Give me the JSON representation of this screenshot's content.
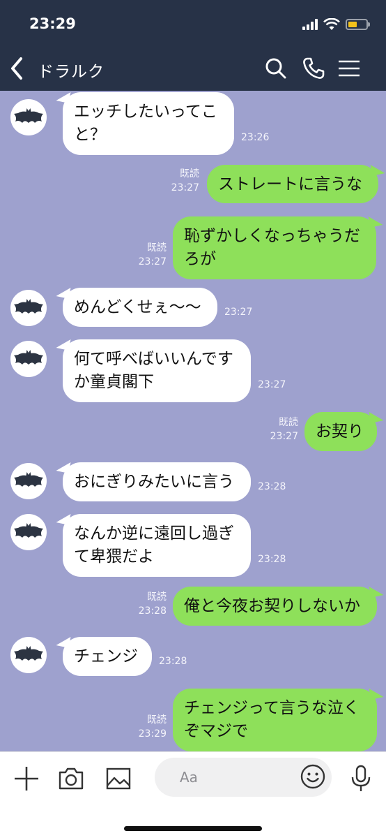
{
  "status": {
    "time": "23:29"
  },
  "header": {
    "title": "ドラルク"
  },
  "messages": [
    {
      "from": "them",
      "text": "エッチしたいってこと？",
      "lines": [
        "エッチしたいってこ",
        "と？"
      ],
      "time": "23:26"
    },
    {
      "from": "me",
      "text": "ストレートに言うな",
      "lines": [
        "ストレートに言うな"
      ],
      "read": "既読",
      "time": "23:27"
    },
    {
      "from": "me",
      "text": "恥ずかしくなっちゃうだろが",
      "lines": [
        "恥ずかしくなっちゃうだ",
        "ろが"
      ],
      "read": "既読",
      "time": "23:27"
    },
    {
      "from": "them",
      "text": "めんどくせぇ〜〜",
      "lines": [
        "めんどくせぇ〜〜"
      ],
      "time": "23:27"
    },
    {
      "from": "them",
      "text": "何て呼べばいいんですか童貞閣下",
      "lines": [
        "何て呼べばいいんです",
        "か童貞閣下"
      ],
      "time": "23:27"
    },
    {
      "from": "me",
      "text": "お契り",
      "lines": [
        "お契り"
      ],
      "read": "既読",
      "time": "23:27"
    },
    {
      "from": "them",
      "text": "おにぎりみたいに言う",
      "lines": [
        "おにぎりみたいに言う"
      ],
      "time": "23:28"
    },
    {
      "from": "them",
      "text": "なんか逆に遠回し過ぎて卑猥だよ",
      "lines": [
        "なんか逆に遠回し過ぎ",
        "て卑猥だよ"
      ],
      "time": "23:28"
    },
    {
      "from": "me",
      "text": "俺と今夜お契りしないか",
      "lines": [
        "俺と今夜お契りしないか"
      ],
      "read": "既読",
      "time": "23:28"
    },
    {
      "from": "them",
      "text": "チェンジ",
      "lines": [
        "チェンジ"
      ],
      "time": "23:28"
    },
    {
      "from": "me",
      "text": "チェンジって言うな泣くぞマジで",
      "lines": [
        "チェンジって言うな泣く",
        "ぞマジで"
      ],
      "read": "既読",
      "time": "23:29"
    }
  ],
  "composer": {
    "placeholder": "Aa"
  },
  "icons": {
    "back": "chevron-left-icon",
    "search": "search-icon",
    "call": "phone-icon",
    "menu": "menu-icon",
    "add": "plus-icon",
    "camera": "camera-icon",
    "image": "image-icon",
    "emoji": "emoji-icon",
    "mic": "microphone-icon",
    "avatar": "bat-icon"
  },
  "colors": {
    "header_bg": "#273247",
    "chat_bg": "#9ea1ce",
    "outgoing_bubble": "#8ee05a",
    "incoming_bubble": "#ffffff"
  }
}
